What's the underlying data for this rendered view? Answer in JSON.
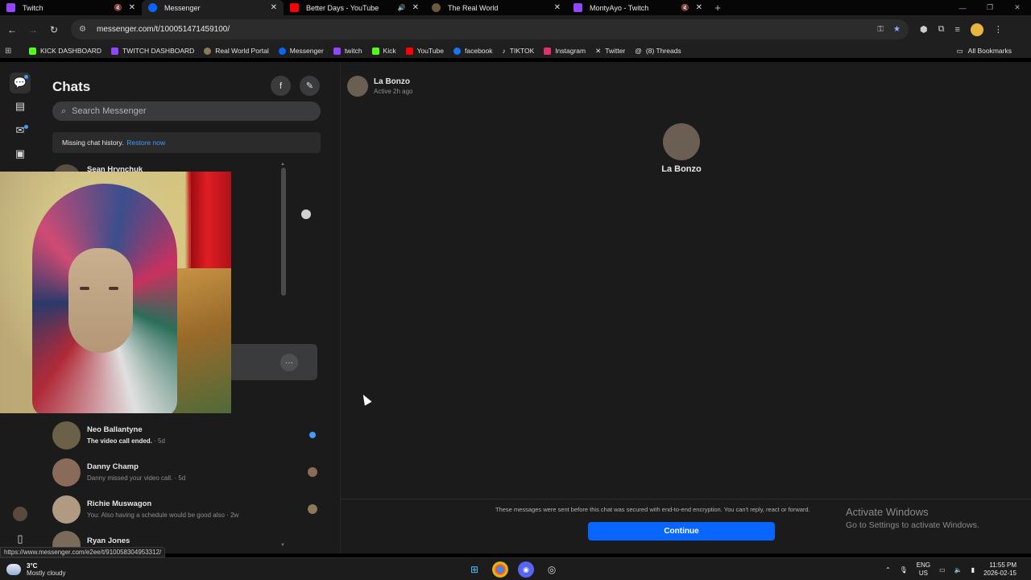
{
  "browser": {
    "tabs": [
      {
        "title": "Twitch",
        "color": "#9146ff",
        "muted": true
      },
      {
        "title": "Messenger",
        "color": "#0866ff",
        "active": true
      },
      {
        "title": "Better Days - YouTube",
        "color": "#ff0000",
        "audio": true
      },
      {
        "title": "The Real World",
        "color": "#6b5a3a"
      },
      {
        "title": "MontyAyo - Twitch",
        "color": "#9146ff",
        "muted": true
      }
    ],
    "url": "messenger.com/t/100051471459100/",
    "bookmarks": [
      {
        "label": "KICK DASHBOARD",
        "color": "#53fc18"
      },
      {
        "label": "TWITCH DASHBOARD",
        "color": "#9146ff"
      },
      {
        "label": "Real World Portal",
        "color": "#8a7a5a"
      },
      {
        "label": "Messenger",
        "color": "#0866ff"
      },
      {
        "label": "twitch",
        "color": "#9146ff"
      },
      {
        "label": "Kick",
        "color": "#53fc18"
      },
      {
        "label": "YouTube",
        "color": "#ff0000"
      },
      {
        "label": "facebook",
        "color": "#1877f2"
      },
      {
        "label": "TIKTOK",
        "color": "#ffffff"
      },
      {
        "label": "Instagram",
        "color": "#e1306c"
      },
      {
        "label": "Twitter",
        "color": "#ffffff"
      },
      {
        "label": "(8) Threads",
        "color": "#ffffff"
      }
    ],
    "all_bookmarks": "All Bookmarks",
    "status_url": "https://www.messenger.com/e2ee/t/910058304953312/"
  },
  "sidebar": {
    "title": "Chats",
    "search_placeholder": "Search Messenger",
    "notice_text": "Missing chat history.",
    "notice_link": "Restore now",
    "partial_name": "Sean Hrynchuk",
    "chats": [
      {
        "name": "Neo Ballantyne",
        "preview": "The video call ended.",
        "time": " · 5d",
        "unread": true,
        "avatar_color": "#6b6048"
      },
      {
        "name": "Danny Champ",
        "preview": "Danny missed your video call.",
        "time": " · 5d",
        "unread": false,
        "avatar_color": "#8a6a58"
      },
      {
        "name": "Richie Muswagon",
        "preview": "You: Also having a schedule would be good also",
        "time": " · 2w",
        "unread": false,
        "avatar_color": "#b09b82"
      },
      {
        "name": "Ryan Jones",
        "preview": "",
        "time": "",
        "unread": false,
        "avatar_color": "#7a6a5a"
      }
    ]
  },
  "conversation": {
    "name": "La Bonzo",
    "status": "Active 2h ago",
    "center_name": "La Bonzo",
    "encryption_note": "These messages were sent before this chat was secured with end-to-end encryption. You can't reply, react or forward.",
    "continue_label": "Continue"
  },
  "watermark": {
    "title": "Activate Windows",
    "subtitle": "Go to Settings to activate Windows."
  },
  "taskbar": {
    "temp": "3°C",
    "weather": "Mostly cloudy",
    "lang1": "ENG",
    "lang2": "US",
    "time": "11:55 PM",
    "date": "2026-02-15"
  }
}
